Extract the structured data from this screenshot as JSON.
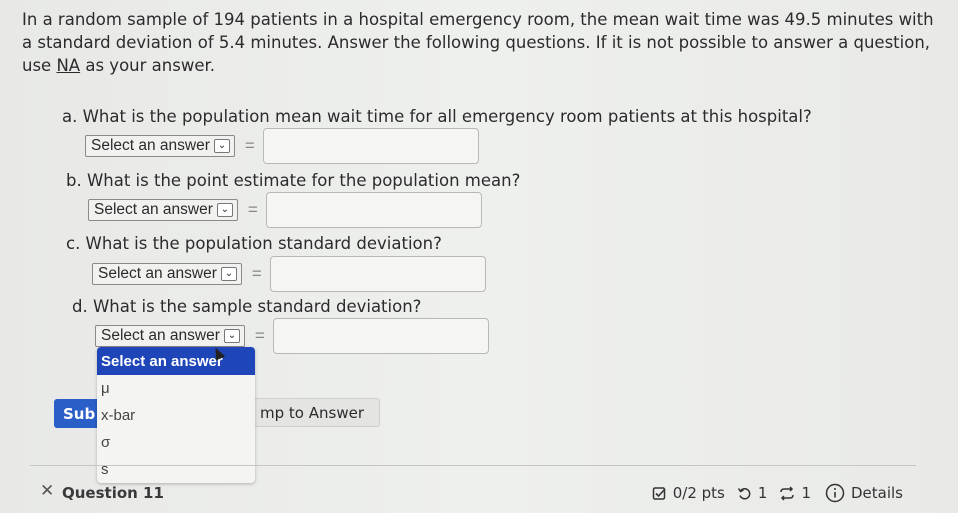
{
  "problem": {
    "intro": "In a random sample of 194 patients in a hospital emergency room, the mean wait time was 49.5 minutes with a standard deviation of 5.4 minutes. Answer the following questions. If it is not possible to answer a question, use",
    "na_label": "NA",
    "intro_end": "as your answer."
  },
  "questions": [
    {
      "label": "a. What is the population mean wait time for all emergency room patients at this hospital?",
      "select_value": "Select an answer",
      "equals": "=",
      "input_value": ""
    },
    {
      "label": "b. What is the point estimate for the population mean?",
      "select_value": "Select an answer",
      "equals": "=",
      "input_value": ""
    },
    {
      "label": "c. What is the population standard deviation?",
      "select_value": "Select an answer",
      "equals": "=",
      "input_value": ""
    },
    {
      "label": "d. What is the sample standard deviation?",
      "select_value": "Select an answer",
      "equals": "=",
      "input_value": ""
    }
  ],
  "dropdown": {
    "options": [
      "Select an answer",
      "μ",
      "x-bar",
      "σ",
      "s"
    ],
    "highlighted": "Select an answer"
  },
  "buttons": {
    "submit": "Sub",
    "jump": "mp to Answer"
  },
  "footer": {
    "close_glyph": "✕",
    "question": "Question 11",
    "points": "0/2 pts",
    "retries": "1",
    "attempts": "1",
    "details": "Details"
  }
}
